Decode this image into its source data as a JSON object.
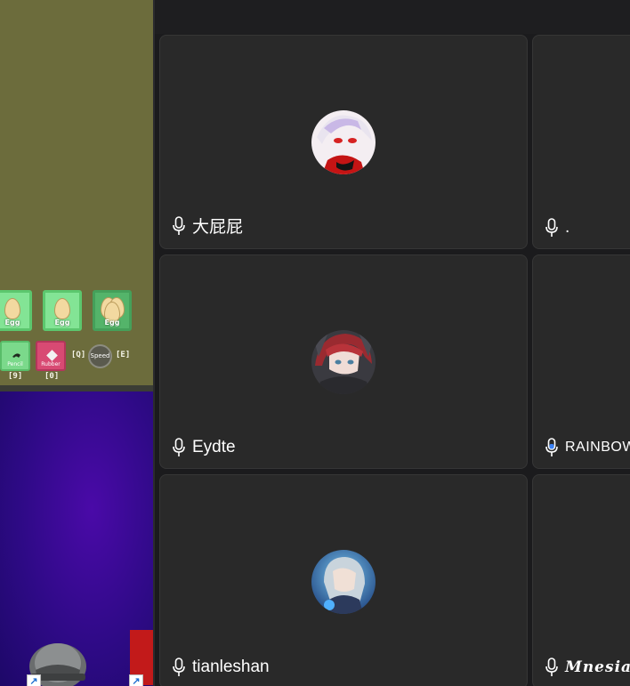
{
  "game": {
    "egg_slots": [
      {
        "label": "Egg"
      },
      {
        "label": "Egg"
      },
      {
        "label": "Egg"
      }
    ],
    "tools": [
      {
        "label": "Pencil",
        "key": "[9]"
      },
      {
        "label": "Rubber",
        "key": "[0]"
      }
    ],
    "speed": {
      "label": "Speed",
      "key_left": "[Q]",
      "key_right": "[E]"
    }
  },
  "desktop": {
    "icons": [
      "helmet-game-icon",
      "red-game-icon"
    ]
  },
  "meeting": {
    "participants": [
      {
        "name": "大屁屁",
        "mic": "microphone-icon",
        "avatar": "anime-white-hair-avatar"
      },
      {
        "name": ".",
        "mic": "microphone-icon",
        "avatar": ""
      },
      {
        "name": "Eydte",
        "mic": "microphone-icon",
        "avatar": "anime-red-hair-avatar"
      },
      {
        "name": "RAINBOW",
        "mic": "microphone-icon-speaking",
        "avatar": ""
      },
      {
        "name": "tianleshan",
        "mic": "microphone-icon",
        "avatar": "anime-blue-avatar"
      },
      {
        "name": "Mnesia",
        "mic": "microphone-icon",
        "avatar": ""
      }
    ],
    "colors": {
      "tile_bg": "#292929",
      "tile_border": "#363636",
      "speaking_mic": "#3b82f6"
    }
  }
}
